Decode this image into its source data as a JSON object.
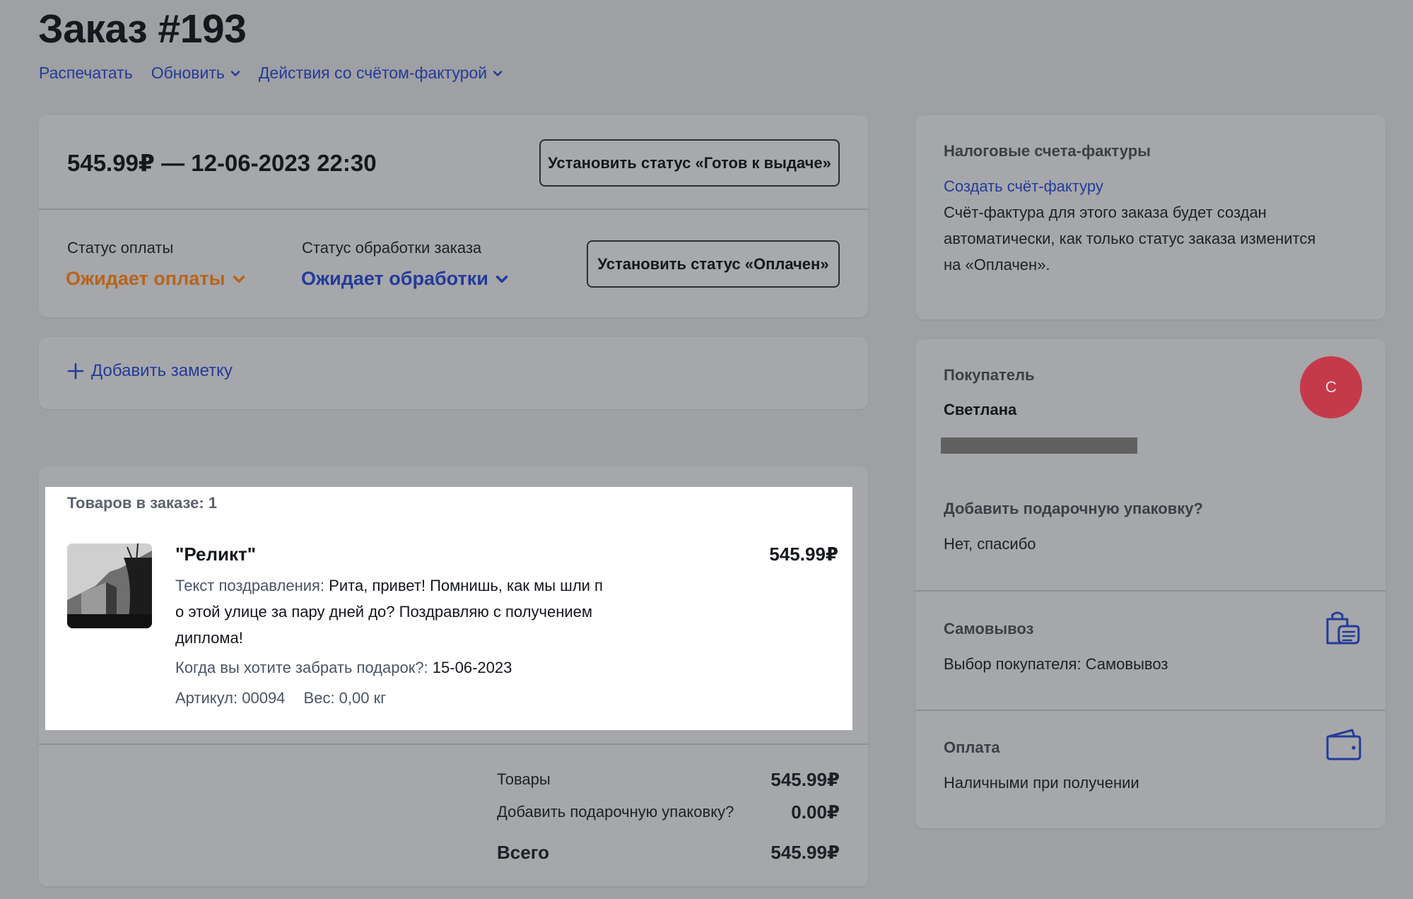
{
  "header": {
    "title": "Заказ  #193",
    "actions": {
      "print": "Распечатать",
      "update": "Обновить",
      "invoice_actions": "Действия со счётом-фактурой"
    }
  },
  "order_summary": {
    "price_date": "545.99₽ — 12-06-2023 22:30",
    "ready_button": "Установить статус «Готов к выдаче»",
    "payment_status_label": "Статус оплаты",
    "payment_status_value": "Ожидает оплаты",
    "processing_status_label": "Статус обработки заказа",
    "processing_status_value": "Ожидает обработки",
    "paid_button": "Установить статус «Оплачен»"
  },
  "note": {
    "add_label": "Добавить заметку"
  },
  "items": {
    "count_label": "Товаров в заказе: 1",
    "product": {
      "name": "\"Реликт\"",
      "price": "545.99₽",
      "greeting_label": "Текст поздравления:",
      "greeting_line1": "Рита, привет! Помнишь, как мы шли п",
      "greeting_line2": "о этой улице за пару дней до? Поздравляю с получением",
      "greeting_line3": "диплома!",
      "pickup_label": "Когда вы хотите забрать подарок?:",
      "pickup_value": "15-06-2023",
      "sku": "Артикул: 00094",
      "weight": "Вес: 0,00 кг"
    },
    "totals": {
      "goods_label": "Товары",
      "goods_value": "545.99₽",
      "gift_label": "Добавить подарочную упаковку?",
      "gift_value": "0.00₽",
      "total_label": "Всего",
      "total_value": "545.99₽"
    }
  },
  "invoices": {
    "title": "Налоговые счета-фактуры",
    "create_link": "Создать счёт-фактуру",
    "line1": "Счёт-фактура для этого заказа будет создан",
    "line2": "автоматически, как только статус заказа изменится",
    "line3": "на «Оплачен»."
  },
  "customer": {
    "title": "Покупатель",
    "name": "Светлана",
    "avatar_letter": "С",
    "gift_question": "Добавить подарочную упаковку?",
    "gift_answer": "Нет, спасибо",
    "shipping_title": "Самовывоз",
    "shipping_value": "Выбор покупателя: Самовывоз",
    "payment_title": "Оплата",
    "payment_value": "Наличными при получении"
  },
  "colors": {
    "accent_blue": "#233b9a",
    "pending_orange": "#b7641c",
    "avatar_red": "#c53a4b",
    "background": "#9fa0a3"
  }
}
